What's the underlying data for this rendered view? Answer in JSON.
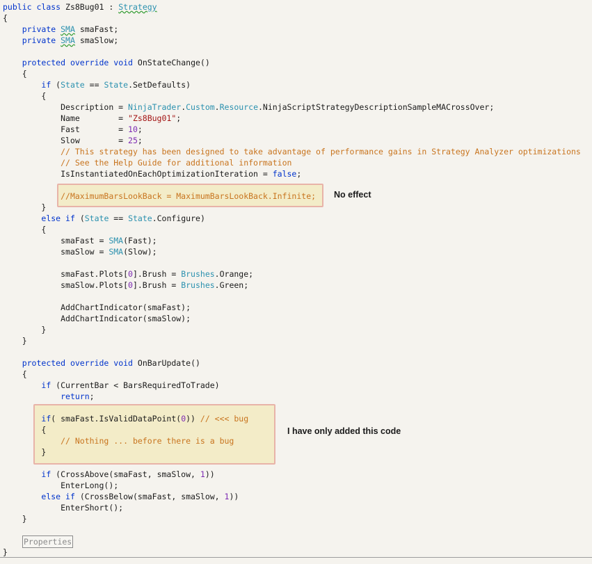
{
  "code_lines": [
    "public class Zs8Bug01 : Strategy",
    "{",
    "    private SMA smaFast;",
    "    private SMA smaSlow;",
    "",
    "    protected override void OnStateChange()",
    "    {",
    "        if (State == State.SetDefaults)",
    "        {",
    "            Description = NinjaTrader.Custom.Resource.NinjaScriptStrategyDescriptionSampleMACrossOver;",
    "            Name        = \"Zs8Bug01\";",
    "            Fast        = 10;",
    "            Slow        = 25;",
    "            // This strategy has been designed to take advantage of performance gains in Strategy Analyzer optimizations",
    "            // See the Help Guide for additional information",
    "            IsInstantiatedOnEachOptimizationIteration = false;",
    "",
    "            //MaximumBarsLookBack = MaximumBarsLookBack.Infinite;",
    "        }",
    "        else if (State == State.Configure)",
    "        {",
    "            smaFast = SMA(Fast);",
    "            smaSlow = SMA(Slow);",
    "",
    "            smaFast.Plots[0].Brush = Brushes.Orange;",
    "            smaSlow.Plots[0].Brush = Brushes.Green;",
    "",
    "            AddChartIndicator(smaFast);",
    "            AddChartIndicator(smaSlow);",
    "        }",
    "    }",
    "",
    "    protected override void OnBarUpdate()",
    "    {",
    "        if (CurrentBar < BarsRequiredToTrade)",
    "            return;",
    "",
    "        if( smaFast.IsValidDataPoint(0)) // <<< bug",
    "        {",
    "            // Nothing ... before there is a bug",
    "        }",
    "",
    "        if (CrossAbove(smaFast, smaSlow, 1))",
    "            EnterLong();",
    "        else if (CrossBelow(smaFast, smaSlow, 1))",
    "            EnterShort();",
    "    }",
    "",
    "    ",
    "}"
  ],
  "properties_region_label": "Properties",
  "annotations": {
    "no_effect": "No effect",
    "added_code": "I have only added this code"
  },
  "colors": {
    "background": "#f5f3ee",
    "keyword": "#0033cc",
    "type": "#2b91af",
    "string": "#a31515",
    "comment": "#c8741e",
    "number": "#7d2ab3",
    "highlight_border": "#e8b3a8",
    "highlight_fill": "#f3ecc8"
  }
}
